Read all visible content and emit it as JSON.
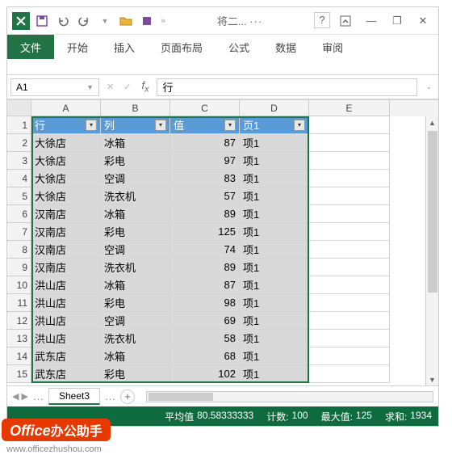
{
  "titlebar": {
    "text": "将二...",
    "dots": "»"
  },
  "tabs": [
    "文件",
    "开始",
    "插入",
    "页面布局",
    "公式",
    "数据",
    "审阅"
  ],
  "active_tab": 0,
  "namebox": "A1",
  "formula": "行",
  "columns": [
    "A",
    "B",
    "C",
    "D",
    "E"
  ],
  "table_headers": [
    "行",
    "列",
    "值",
    "页1"
  ],
  "rows": [
    {
      "n": 1
    },
    {
      "n": 2,
      "a": "大徐店",
      "b": "冰箱",
      "c": "87",
      "d": "项1"
    },
    {
      "n": 3,
      "a": "大徐店",
      "b": "彩电",
      "c": "97",
      "d": "项1"
    },
    {
      "n": 4,
      "a": "大徐店",
      "b": "空调",
      "c": "83",
      "d": "项1"
    },
    {
      "n": 5,
      "a": "大徐店",
      "b": "洗衣机",
      "c": "57",
      "d": "项1"
    },
    {
      "n": 6,
      "a": "汉南店",
      "b": "冰箱",
      "c": "89",
      "d": "项1"
    },
    {
      "n": 7,
      "a": "汉南店",
      "b": "彩电",
      "c": "125",
      "d": "项1"
    },
    {
      "n": 8,
      "a": "汉南店",
      "b": "空调",
      "c": "74",
      "d": "项1"
    },
    {
      "n": 9,
      "a": "汉南店",
      "b": "洗衣机",
      "c": "89",
      "d": "项1"
    },
    {
      "n": 10,
      "a": "洪山店",
      "b": "冰箱",
      "c": "87",
      "d": "项1"
    },
    {
      "n": 11,
      "a": "洪山店",
      "b": "彩电",
      "c": "98",
      "d": "项1"
    },
    {
      "n": 12,
      "a": "洪山店",
      "b": "空调",
      "c": "69",
      "d": "项1"
    },
    {
      "n": 13,
      "a": "洪山店",
      "b": "洗衣机",
      "c": "58",
      "d": "项1"
    },
    {
      "n": 14,
      "a": "武东店",
      "b": "冰箱",
      "c": "68",
      "d": "项1"
    },
    {
      "n": 15,
      "a": "武东店",
      "b": "彩电",
      "c": "102",
      "d": "项1"
    }
  ],
  "sheet_tab": "Sheet3",
  "status": {
    "avg_label": "平均值",
    "avg": "80.58333333",
    "count_label": "计数:",
    "count": "100",
    "max_label": "最大值:",
    "max": "125",
    "sum_label": "求和:",
    "sum": "1934"
  },
  "badge": {
    "en": "Office",
    "cn": "办公助手"
  },
  "watermark": "www.officezhushou.com",
  "icons": {
    "save": "save-icon",
    "undo": "undo-icon",
    "redo": "redo-icon",
    "open": "open-icon",
    "quick": "quick-icon",
    "help": "?",
    "win_opts": "win-opts-icon",
    "min": "—",
    "restore": "❐",
    "close": "✕"
  }
}
